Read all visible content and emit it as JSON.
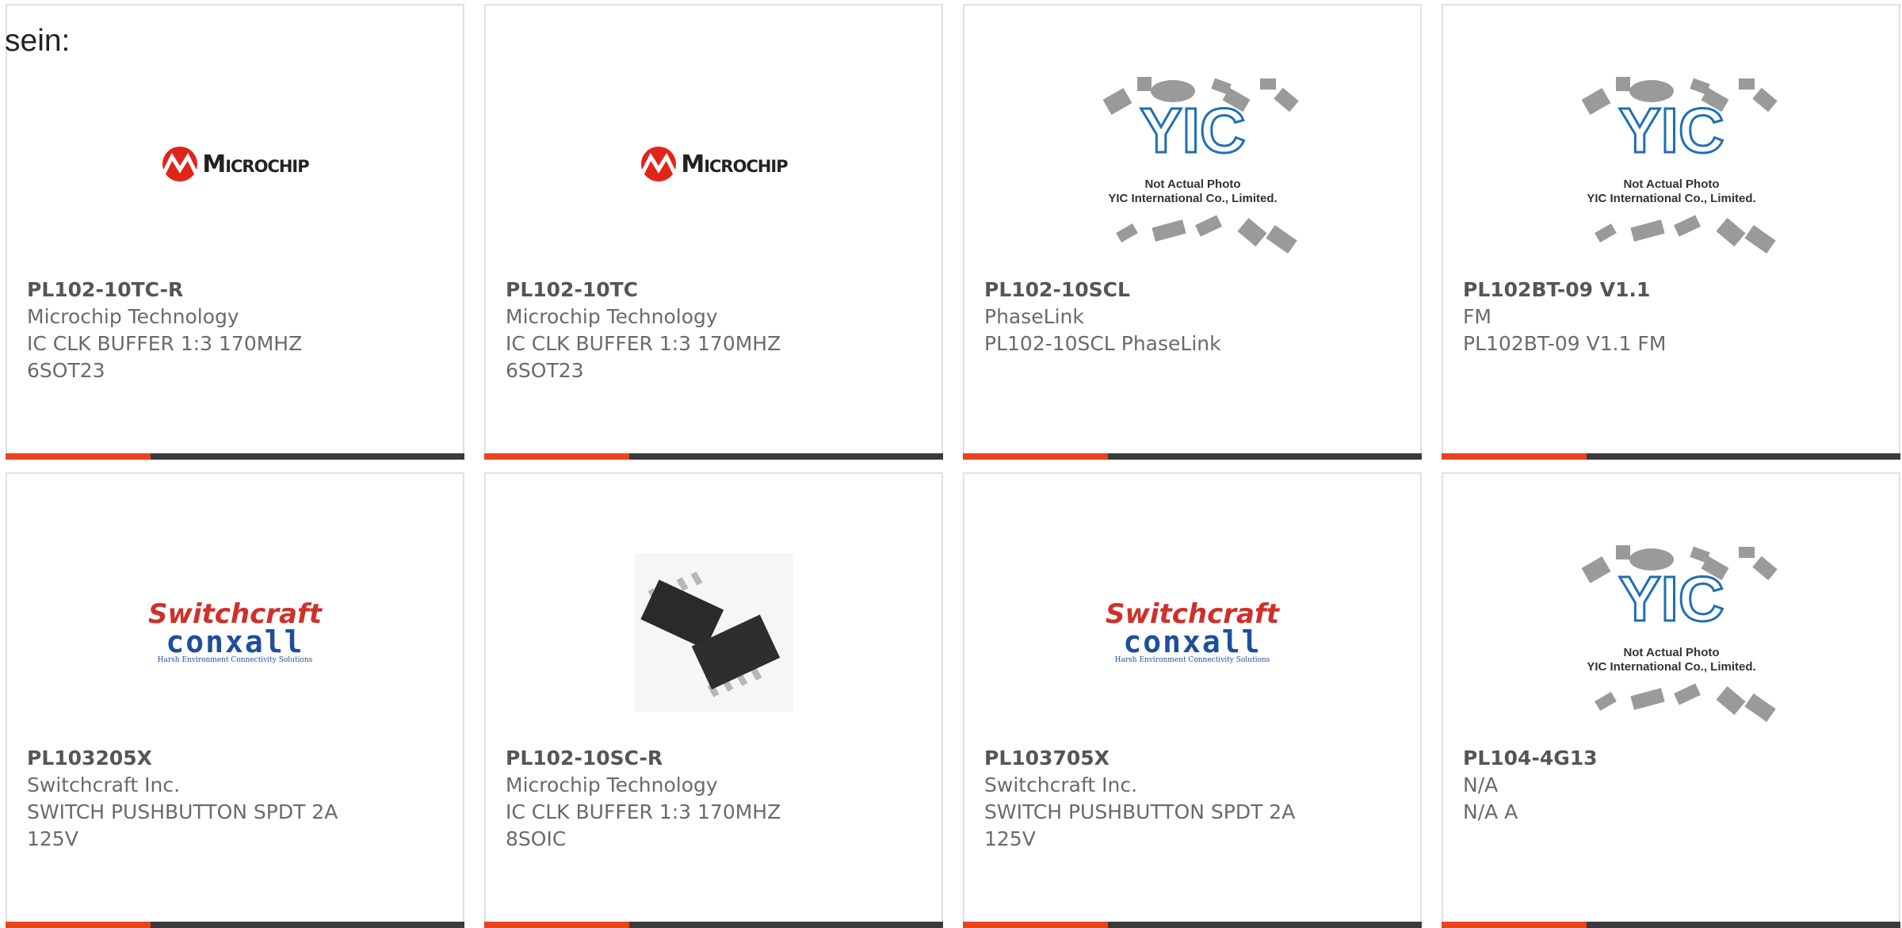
{
  "page_label": "sein:",
  "accent_color": "#e8441e",
  "bar_color": "#3b3b3b",
  "logos": {
    "microchip": "Microchip",
    "switchcraft_top": "Switchcraft",
    "switchcraft_bottom": "conxall",
    "switchcraft_tag": "Harsh Environment Connectivity Solutions",
    "yic_line1": "Not Actual Photo",
    "yic_line2": "YIC International Co., Limited."
  },
  "products": [
    {
      "image": "microchip-logo",
      "part": "PL102-10TC-R",
      "maker": "Microchip Technology",
      "desc": "IC CLK BUFFER 1:3 170MHZ\n6SOT23"
    },
    {
      "image": "microchip-logo",
      "part": "PL102-10TC",
      "maker": "Microchip Technology",
      "desc": "IC CLK BUFFER 1:3 170MHZ\n6SOT23"
    },
    {
      "image": "yic-placeholder",
      "part": "PL102-10SCL",
      "maker": "PhaseLink",
      "desc": "PL102-10SCL PhaseLink"
    },
    {
      "image": "yic-placeholder",
      "part": "PL102BT-09 V1.1",
      "maker": "FM",
      "desc": "PL102BT-09 V1.1 FM"
    },
    {
      "image": "switchcraft-logo",
      "part": "PL103205X",
      "maker": "Switchcraft Inc.",
      "desc": "SWITCH PUSHBUTTON SPDT 2A\n125V"
    },
    {
      "image": "soic-chip-photo",
      "part": "PL102-10SC-R",
      "maker": "Microchip Technology",
      "desc": "IC CLK BUFFER 1:3 170MHZ\n8SOIC"
    },
    {
      "image": "switchcraft-logo",
      "part": "PL103705X",
      "maker": "Switchcraft Inc.",
      "desc": "SWITCH PUSHBUTTON SPDT 2A\n125V"
    },
    {
      "image": "yic-placeholder",
      "part": "PL104-4G13",
      "maker": "N/A",
      "desc": "N/A A"
    }
  ]
}
